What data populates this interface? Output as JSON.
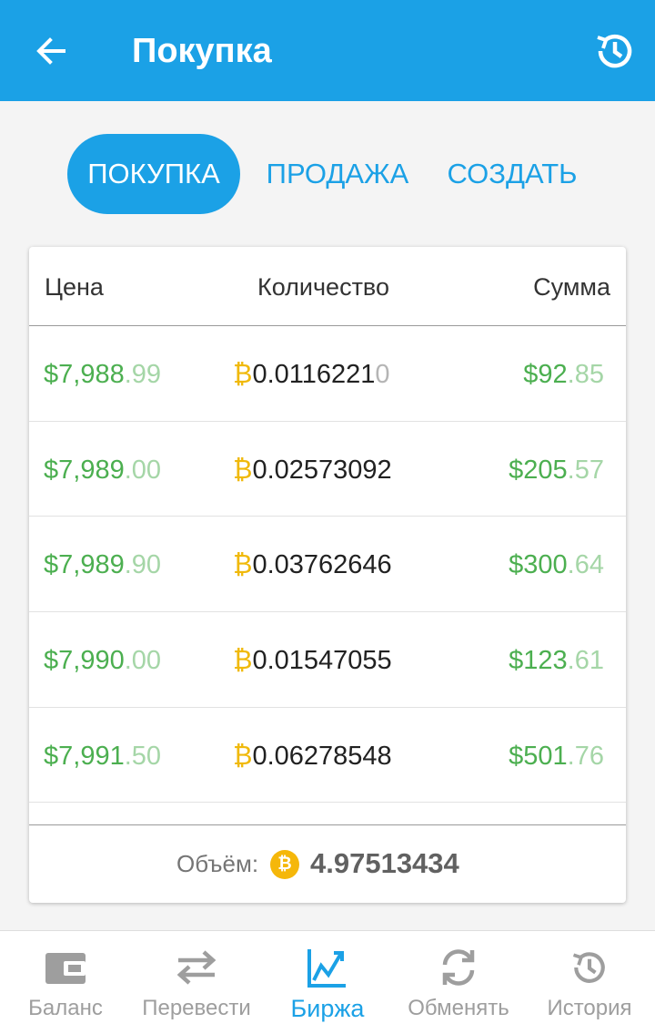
{
  "appbar": {
    "title": "Покупка"
  },
  "tabs": [
    {
      "label": "ПОКУПКА",
      "active": true
    },
    {
      "label": "ПРОДАЖА",
      "active": false
    },
    {
      "label": "СОЗДАТЬ",
      "active": false
    }
  ],
  "table": {
    "headers": {
      "price": "Цена",
      "quantity": "Количество",
      "sum": "Сумма"
    },
    "rows": [
      {
        "price_main": "$7,988",
        "price_frac": ".99",
        "btc_symbol": "₿",
        "qty_main": "0.0116221",
        "qty_tail": "0",
        "sum_main": "$92",
        "sum_frac": ".85"
      },
      {
        "price_main": "$7,989",
        "price_frac": ".00",
        "btc_symbol": "₿",
        "qty_main": "0.02573092",
        "qty_tail": "",
        "sum_main": "$205",
        "sum_frac": ".57"
      },
      {
        "price_main": "$7,989",
        "price_frac": ".90",
        "btc_symbol": "₿",
        "qty_main": "0.03762646",
        "qty_tail": "",
        "sum_main": "$300",
        "sum_frac": ".64"
      },
      {
        "price_main": "$7,990",
        "price_frac": ".00",
        "btc_symbol": "₿",
        "qty_main": "0.01547055",
        "qty_tail": "",
        "sum_main": "$123",
        "sum_frac": ".61"
      },
      {
        "price_main": "$7,991",
        "price_frac": ".50",
        "btc_symbol": "₿",
        "qty_main": "0.06278548",
        "qty_tail": "",
        "sum_main": "$501",
        "sum_frac": ".76"
      }
    ],
    "volume": {
      "label": "Объём:",
      "coin_symbol": "₿",
      "value": "4.97513434"
    }
  },
  "bottom_nav": [
    {
      "label": "Баланс",
      "icon": "wallet-icon",
      "active": false
    },
    {
      "label": "Перевести",
      "icon": "transfer-arrows-icon",
      "active": false
    },
    {
      "label": "Биржа",
      "icon": "exchange-chart-icon",
      "active": true
    },
    {
      "label": "Обменять",
      "icon": "swap-refresh-icon",
      "active": false
    },
    {
      "label": "История",
      "icon": "history-clock-icon",
      "active": false
    }
  ],
  "colors": {
    "primary": "#1ba1e6",
    "price_green": "#4caf50",
    "price_green_faded": "#a5d6a7",
    "bitcoin_gold": "#f0b90b",
    "inactive_gray": "#9e9e9e"
  }
}
